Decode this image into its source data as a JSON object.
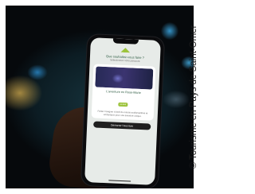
{
  "photo": {
    "credit": "© Tourisme en Pays de Saint-Omer",
    "subject": "hand holding smartphone"
  },
  "phone_screen": {
    "title": "Que souhaitez-vous faire ?",
    "subtitle": "Sélectionnez votre parcours",
    "card_heading": "L'aventure en Rose-Marie",
    "badge": "Gratuit",
    "card_text": "Partez naviguer à bord du marais audiomaritime et embarquez pour une aventure unique.",
    "button_label": "Démarrer l'aventure"
  },
  "colors": {
    "accent": "#9cc33c",
    "screen_title": "#2f5d44",
    "background": "#0c1c23"
  }
}
